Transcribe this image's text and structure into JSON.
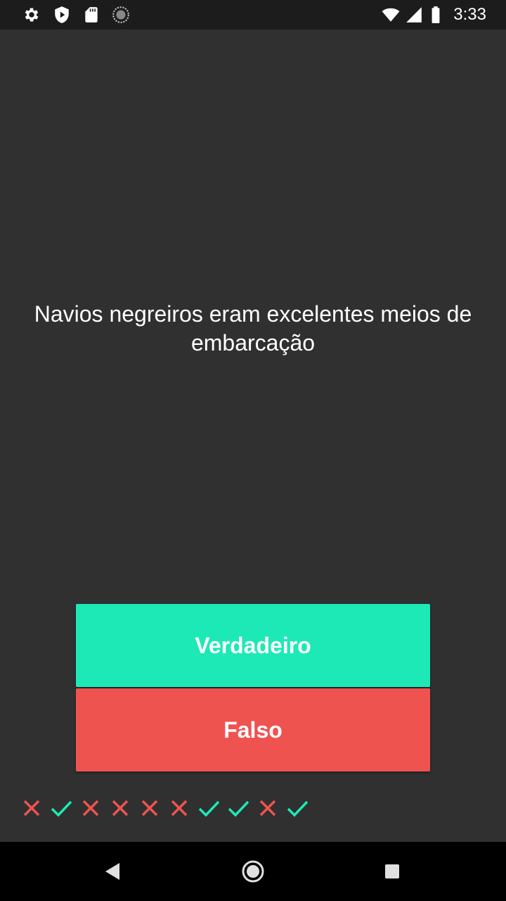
{
  "status_bar": {
    "time": "3:33",
    "icons": [
      "gear-icon",
      "shield-play-icon",
      "sd-card-icon",
      "sync-icon",
      "wifi-icon",
      "signal-icon",
      "battery-icon"
    ]
  },
  "quiz": {
    "question": "Navios negreiros eram excelentes meios de embarcação",
    "true_label": "Verdadeiro",
    "false_label": "Falso",
    "results": [
      "wrong",
      "correct",
      "wrong",
      "wrong",
      "wrong",
      "wrong",
      "correct",
      "correct",
      "wrong",
      "correct"
    ]
  },
  "colors": {
    "background": "#303030",
    "true_button": "#1de9b6",
    "false_button": "#ef5350",
    "correct": "#1de9b6",
    "wrong": "#ef5350"
  },
  "nav_bar": {
    "icons": [
      "back-icon",
      "home-icon",
      "recents-icon"
    ]
  }
}
